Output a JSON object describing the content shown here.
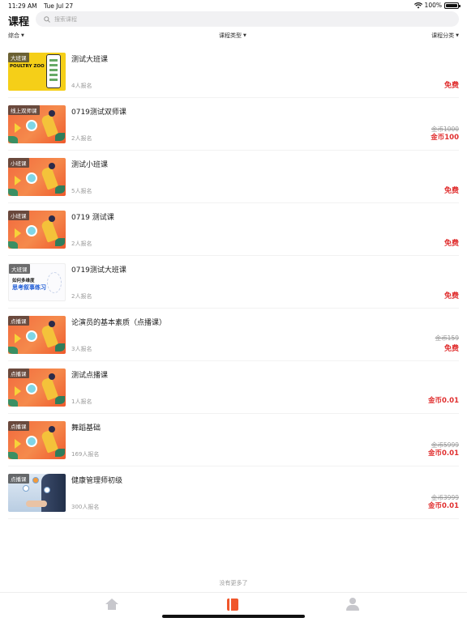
{
  "status_bar": {
    "time": "11:29 AM",
    "date": "Tue Jul 27",
    "battery": "100%"
  },
  "header": {
    "title": "课程",
    "search_placeholder": "搜索课程"
  },
  "filters": [
    {
      "label": "综合"
    },
    {
      "label": "课程类型"
    },
    {
      "label": "课程分类"
    }
  ],
  "courses": [
    {
      "title": "测试大班课",
      "badge": "大班课",
      "enrolled": "4人报名",
      "original_price": "",
      "price": "免费",
      "thumb": "yellow",
      "thumb_text": "POULTRY ZOO"
    },
    {
      "title": "0719测试双师课",
      "badge": "线上双师课",
      "enrolled": "2人报名",
      "original_price": "金币1000",
      "price": "金币100",
      "thumb": "orange"
    },
    {
      "title": "测试小班课",
      "badge": "小班课",
      "enrolled": "5人报名",
      "original_price": "",
      "price": "免费",
      "thumb": "orange"
    },
    {
      "title": "0719 测试课",
      "badge": "小班课",
      "enrolled": "2人报名",
      "original_price": "",
      "price": "免费",
      "thumb": "orange"
    },
    {
      "title": "0719测试大班课",
      "badge": "大班课",
      "enrolled": "2人报名",
      "original_price": "",
      "price": "免费",
      "thumb": "white",
      "thumb_text_1": "如何多维度",
      "thumb_text_2": "思考叙事练习"
    },
    {
      "title": "论演员的基本素质（点播课）",
      "badge": "点播课",
      "enrolled": "3人报名",
      "original_price": "金币159",
      "price": "免费",
      "thumb": "orange"
    },
    {
      "title": "测试点播课",
      "badge": "点播课",
      "enrolled": "1人报名",
      "original_price": "",
      "price": "金币0.01",
      "thumb": "orange"
    },
    {
      "title": "舞蹈基础",
      "badge": "点播课",
      "enrolled": "169人报名",
      "original_price": "金币5999",
      "price": "金币0.01",
      "thumb": "orange"
    },
    {
      "title": "健康管理师初级",
      "badge": "点播课",
      "enrolled": "300人报名",
      "original_price": "金币3999",
      "price": "金币0.01",
      "thumb": "blue"
    }
  ],
  "footer": {
    "no_more": "没有更多了"
  },
  "tabbar": [
    {
      "icon": "home-icon",
      "active": false
    },
    {
      "icon": "book-icon",
      "active": true
    },
    {
      "icon": "user-icon",
      "active": false
    }
  ],
  "colors": {
    "accent": "#f0562b",
    "price": "#e02e2e",
    "muted": "#999999"
  }
}
